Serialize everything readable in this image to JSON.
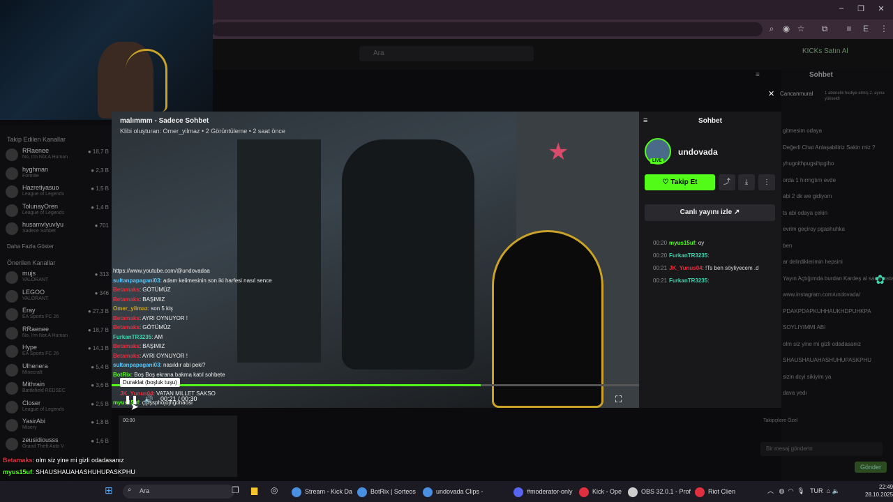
{
  "browser": {
    "icons": [
      "zoom-icon",
      "eye-off-icon",
      "star-icon",
      "extensions-icon",
      "media-icon",
      "profile-icon",
      "menu-icon"
    ],
    "profile_letter": "E",
    "window_buttons": [
      "–",
      "❐",
      "✕"
    ]
  },
  "kick": {
    "search_placeholder": "Ara",
    "ai_label": "KICKs Satın Al"
  },
  "sidebar": {
    "following_header": "Takip Edilen Kanallar",
    "following": [
      {
        "name": "RRaenee",
        "game": "No, I'm Not A Human",
        "viewers": "18,7 B"
      },
      {
        "name": "hyghman",
        "game": "Fortnite",
        "viewers": "2,3 B"
      },
      {
        "name": "Hazretiyasuo",
        "game": "League of Legends",
        "viewers": "1,5 B"
      },
      {
        "name": "TolunayOren",
        "game": "League of Legends",
        "viewers": "1,4 B"
      },
      {
        "name": "husamvlyuvlyu",
        "game": "Sadece Sohbet",
        "viewers": "701"
      }
    ],
    "show_more": "Daha Fazla Göster",
    "recommended_header": "Önerilen Kanallar",
    "recommended": [
      {
        "name": "mujs",
        "game": "VALORANT",
        "viewers": "313"
      },
      {
        "name": "LEGOO",
        "game": "VALORANT",
        "viewers": "346"
      },
      {
        "name": "Eray",
        "game": "EA Sports FC 26",
        "viewers": "27,3 B"
      },
      {
        "name": "RRaenee",
        "game": "No, I'm Not A Human",
        "viewers": "18,7 B"
      },
      {
        "name": "Hype",
        "game": "EA Sports FC 26",
        "viewers": "14,1 B"
      },
      {
        "name": "Ulhenera",
        "game": "Minecraft",
        "viewers": "5,4 B"
      },
      {
        "name": "Mithrain",
        "game": "Battlefield REDSEC",
        "viewers": "3,6 B"
      },
      {
        "name": "Closer",
        "game": "League of Legends",
        "viewers": "2,5 B"
      },
      {
        "name": "YasirAbi",
        "game": "Misery",
        "viewers": "1,8 B"
      },
      {
        "name": "zeusidiousss",
        "game": "Grand Theft Auto V",
        "viewers": "1,6 B"
      }
    ]
  },
  "clip": {
    "title": "malımmm - Sadece Sohbet",
    "meta": "Klibi oluşturan: Omer_yilmaz • 2 Görüntüleme • 2 saat önce",
    "time": "00:21 / 00:30",
    "progress_fraction": 0.7,
    "tooltip": "Duraklat (boşluk tuşu)",
    "overlay_chat": [
      {
        "user": "",
        "text": "https://www.youtube.com/@undovadaa",
        "color": "#eee"
      },
      {
        "user": "sultanpapagani03",
        "text": ": adam kelimesinin son iki harfesi nasıl sence",
        "color": "#53c8fc"
      },
      {
        "user": "Betamaks",
        "text": ": GÖTÜMÜZ",
        "color": "#e03040"
      },
      {
        "user": "Betamaks",
        "text": ": BAŞIMIZ",
        "color": "#e03040"
      },
      {
        "user": "Omer_yilmaz",
        "text": ": son 5 kiş",
        "color": "#c9a227"
      },
      {
        "user": "Betamaks",
        "text": ": AYRI OYNUYOR !",
        "color": "#e03040"
      },
      {
        "user": "Betamaks",
        "text": ": GÖTÜMÜZ",
        "color": "#e03040"
      },
      {
        "user": "FurkanTR3235",
        "text": ": AM",
        "color": "#3ed6b0"
      },
      {
        "user": "Betamaks",
        "text": ": BAŞIMIZ",
        "color": "#e03040"
      },
      {
        "user": "Betamaks",
        "text": ": AYRI OYNUYOR !",
        "color": "#e03040"
      },
      {
        "user": "sultanpapagani03",
        "text": ": nasıldır abi peki?",
        "color": "#53c8fc"
      },
      {
        "user": "BotRix",
        "text": ": Boş Boş ekrana bakma katıl sohbete",
        "color": "#53fc18"
      }
    ],
    "overlay_chat_below": [
      {
        "user": "JK_Yunus04",
        "text": ": VATAN MILLET SAKSO",
        "color": "#e03040"
      },
      {
        "user": "myus15uf",
        "text": ": çşfşsphojojhgohaosi",
        "color": "#53fc18"
      }
    ]
  },
  "clip_panel": {
    "title": "Sohbet",
    "username": "undovada",
    "live_badge": "LIVE",
    "follow_label": "Takip Et",
    "watch_live_label": "Canlı yayını izle ↗",
    "chat": [
      {
        "time": "00:20",
        "user": "myus15uf",
        "text": ": oy",
        "color": "#53fc18"
      },
      {
        "time": "00:20",
        "user": "FurkanTR3235",
        "text": ":",
        "color": "#3ed6b0"
      },
      {
        "time": "00:21",
        "user": "JK_Yunus04",
        "text": ": !Ts ben söyliyecem .d",
        "color": "#e03040"
      },
      {
        "time": "00:21",
        "user": "FurkanTR3235",
        "text": ":",
        "color": "#3ed6b0"
      }
    ]
  },
  "right_chat": {
    "title": "Sohbet",
    "pinned_user": "Cancanmural",
    "pinned_note": "1 abonelik hediye etmiş 2. ayına yükseldi",
    "lines": [
      "gitmesim odaya",
      "Değerli Chat Anlaşabiliriz Sakin miz ?",
      "yhugoithpugsihpgiho",
      "orda 1 hırmgtım evde",
      "abi 2 dk we gidiyom",
      "ts abi odaya çekin",
      "evrim geçiroy pgashuhka",
      "ben",
      "ar delirdiklerimin hepsini",
      "Yayın Açtığımda burdan Kardeş al sana insta",
      "www.instagram.com/undovada/",
      "PDAKPDAPKUHHAUKHDPUHKPA",
      "SOYLIYIMMI ABI",
      "olm siz yine mi gizli odadasanız",
      "SHAUSHAUAHASHUHUPASKPHU",
      "sizin dcyi sikiyim ya",
      "dava yedı"
    ],
    "input_placeholder": "Bir mesaj gönderin",
    "send_label": "Gönder",
    "followers_note": "Takipçilere Özel"
  },
  "bottom_chat": [
    {
      "user": "Betamaks",
      "text": ": olm siz yine mi gizli odadasanız",
      "color": "#e03040"
    },
    {
      "user": "myus15uf",
      "text": ": SHAUSHAUAHASHUHUPASKPHU",
      "color": "#53fc18"
    },
    {
      "user": "Betamaks",
      "text": ": sizin dcyi sikiyim ya",
      "color": "#e03040"
    },
    {
      "user": "JK_Yunus04",
      "text": ": dava yedı",
      "color": "#e03040"
    }
  ],
  "taskbar": {
    "search_placeholder": "Ara",
    "apps": [
      {
        "label": "Stream - Kick Da",
        "color": "#4a90e2"
      },
      {
        "label": "BotRix | Sorteos",
        "color": "#4a90e2"
      },
      {
        "label": "undovada Clips -",
        "color": "#4a90e2"
      },
      {
        "label": "#moderator-only",
        "color": "#5865f2"
      },
      {
        "label": "Kick - Ope",
        "color": "#e03040"
      },
      {
        "label": "OBS 32.0.1 - Prof",
        "color": "#ccc"
      },
      {
        "label": "Riot Clien",
        "color": "#e03040"
      }
    ],
    "lang": "TUR",
    "time": "22:49",
    "date": "28.10.2025"
  },
  "video": {
    "top_time_label": "00:00"
  }
}
